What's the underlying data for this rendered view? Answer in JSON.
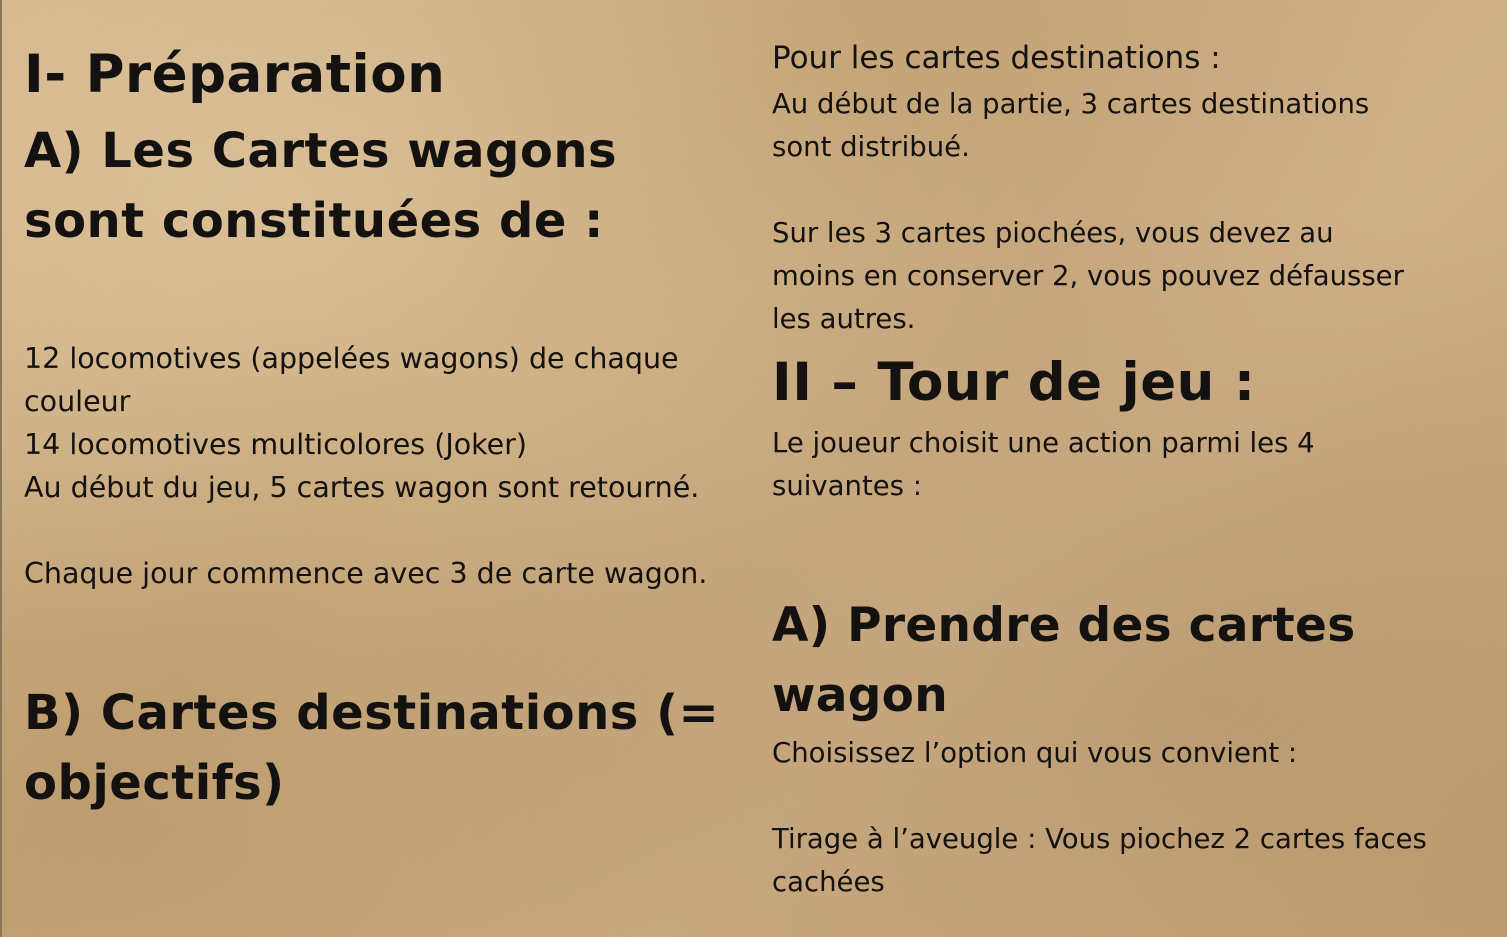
{
  "left": {
    "title": "I- Préparation",
    "section_a_heading": "A) Les Cartes wagons\nsont constituées de :",
    "section_a_body": "12 locomotives (appelées wagons) de chaque\ncouleur\n14 locomotives multicolores (Joker)\nAu début du jeu, 5 cartes wagon sont retourné.\n\nChaque jour commence avec 3 de carte wagon.",
    "section_b_heading": "B) Cartes destinations (=\nobjectifs)"
  },
  "right": {
    "destinations_label": "Pour les cartes destinations :",
    "destinations_body": " Au début de la partie, 3 cartes destinations\nsont distribué.\n\nSur les 3 cartes piochées, vous devez au\nmoins en conserver 2, vous pouvez défausser\nles autres.",
    "tour_heading": "II – Tour de jeu :",
    "tour_body": "Le joueur choisit une action parmi les 4\nsuivantes :",
    "prendre_heading": "A) Prendre des cartes\nwagon",
    "prendre_body": "Choisissez l’option qui vous convient :\n\nTirage à l’aveugle : Vous piochez 2 cartes faces\ncachées"
  }
}
